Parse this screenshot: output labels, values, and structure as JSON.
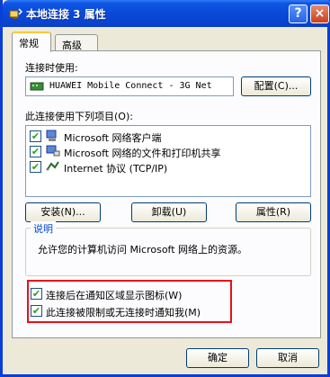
{
  "window": {
    "title": "本地连接 3 属性",
    "help_button": "?",
    "close_button": "×"
  },
  "tabs": [
    {
      "label": "常规",
      "active": true
    },
    {
      "label": "高级",
      "active": false
    }
  ],
  "connect_using": {
    "label": "连接时使用:",
    "device": "HUAWEI Mobile Connect - 3G Net",
    "configure_button": "配置(C)..."
  },
  "items": {
    "label": "此连接使用下列项目(O):",
    "list": [
      {
        "checked": true,
        "text": "Microsoft 网络客户端",
        "icon": "network-client-icon"
      },
      {
        "checked": true,
        "text": "Microsoft 网络的文件和打印机共享",
        "icon": "file-printer-sharing-icon"
      },
      {
        "checked": true,
        "text": "Internet 协议 (TCP/IP)",
        "icon": "protocol-icon"
      }
    ]
  },
  "buttons": {
    "install": "安装(N)...",
    "uninstall": "卸载(U)",
    "properties": "属性(R)"
  },
  "description": {
    "title": "说明",
    "text": "允许您的计算机访问 Microsoft 网络上的资源。"
  },
  "options": [
    {
      "checked": true,
      "text": "连接后在通知区域显示图标(W)"
    },
    {
      "checked": true,
      "text": "此连接被限制或无连接时通知我(M)"
    }
  ],
  "footer": {
    "ok": "确定",
    "cancel": "取消"
  },
  "colors": {
    "titlebar": "#0a49d8",
    "highlight_box": "#e8101a",
    "tab_accent": "#ffc83c"
  }
}
